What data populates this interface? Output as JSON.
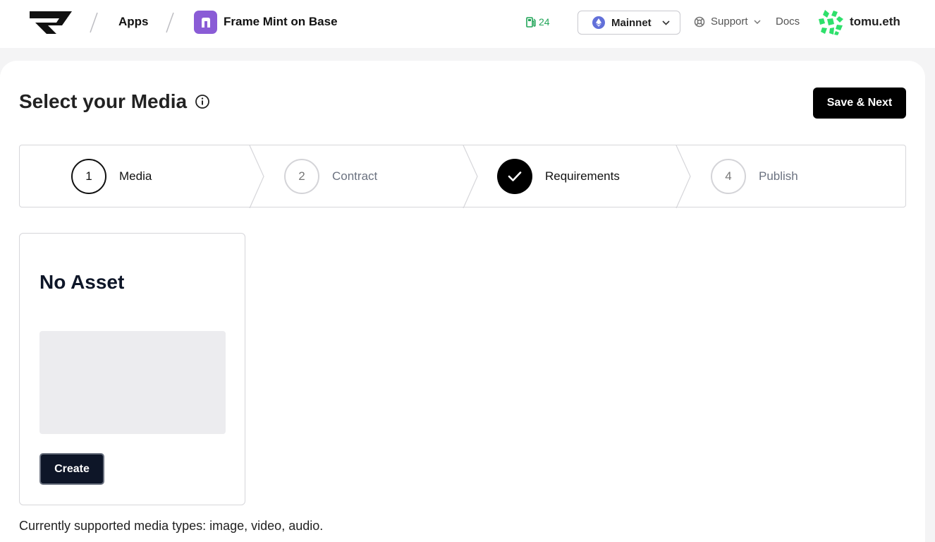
{
  "header": {
    "breadcrumb_apps": "Apps",
    "app_name": "Frame Mint on Base",
    "gas_value": "24",
    "network": "Mainnet",
    "support_label": "Support",
    "docs_label": "Docs",
    "username": "tomu.eth"
  },
  "page": {
    "title": "Select your Media",
    "save_button": "Save & Next"
  },
  "stepper": {
    "steps": [
      {
        "number": "1",
        "label": "Media",
        "state": "active"
      },
      {
        "number": "2",
        "label": "Contract",
        "state": "idle"
      },
      {
        "number": "",
        "label": "Requirements",
        "state": "done"
      },
      {
        "number": "4",
        "label": "Publish",
        "state": "idle"
      }
    ]
  },
  "asset_card": {
    "title": "No Asset",
    "create_button": "Create"
  },
  "footer_note": "Currently supported media types: image, video, audio.",
  "colors": {
    "app_icon": "#8a5cd6",
    "gas": "#22a559",
    "avatar": "#2ee06b",
    "primary_button": "#000000",
    "create_button": "#0e1628"
  }
}
